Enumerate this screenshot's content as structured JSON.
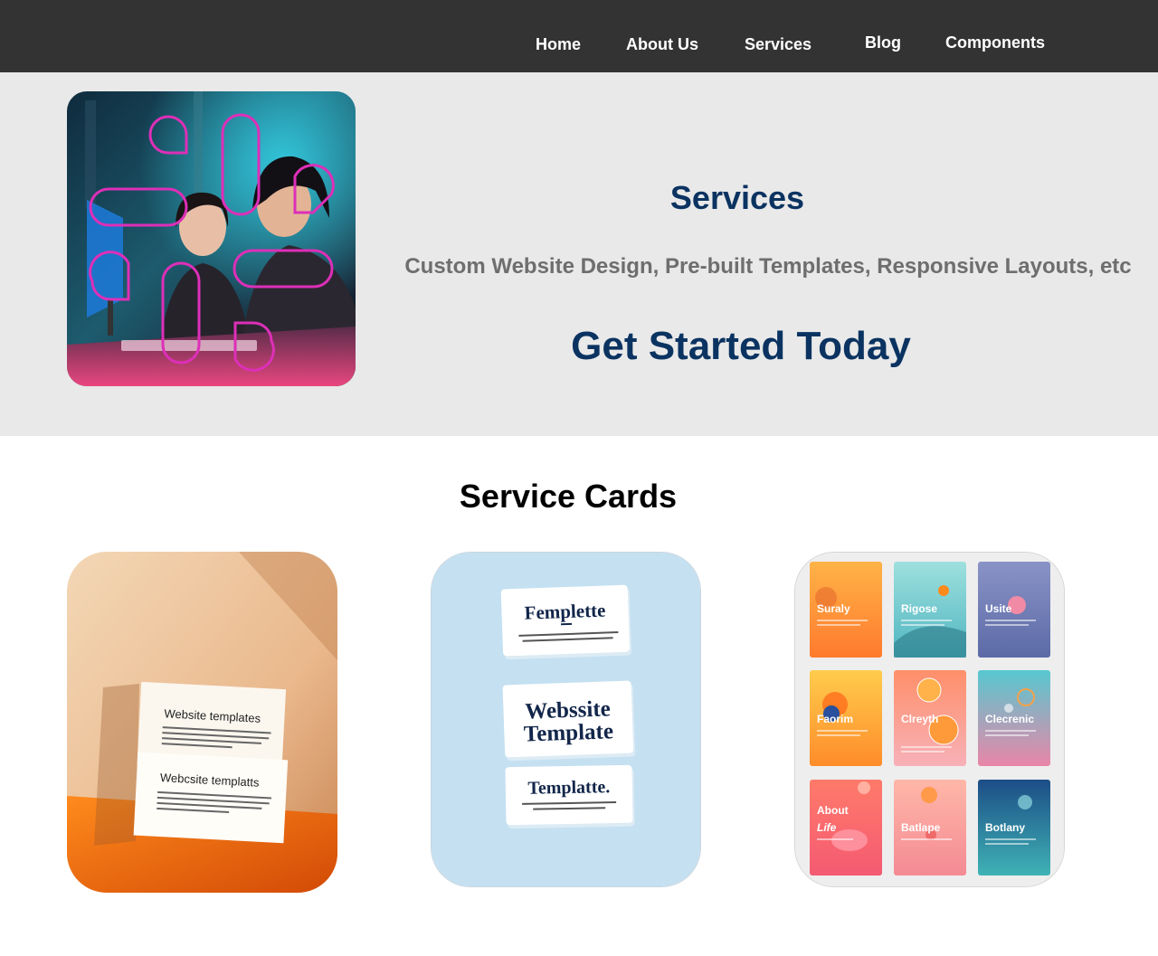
{
  "nav": {
    "items": [
      "Home",
      "About Us",
      "Services",
      "Blog",
      "Components"
    ]
  },
  "hero": {
    "title": "Services",
    "subtitle": "Custom Website Design, Pre-built Templates, Responsive Layouts, etc",
    "cta": "Get Started Today"
  },
  "cards_section": {
    "title": "Service Cards",
    "card1": {
      "top_title": "Website templates",
      "bottom_title": "Webcsite templatts"
    },
    "card2": {
      "title1": "Femplette",
      "title2a": "Webssite",
      "title2b": "Template",
      "title3": "Templatte."
    },
    "card3": {
      "tiles": [
        "Suraly",
        "Rigose",
        "Usite",
        "Faorim",
        "Clreyth",
        "Clecrenic",
        "About",
        "Life",
        "Batlape",
        "Botlany"
      ]
    }
  },
  "colors": {
    "nav_bg": "#333333",
    "hero_bg": "#e9e9e9",
    "accent_navy": "#0b3361",
    "subtitle_gray": "#6e6e6e"
  }
}
